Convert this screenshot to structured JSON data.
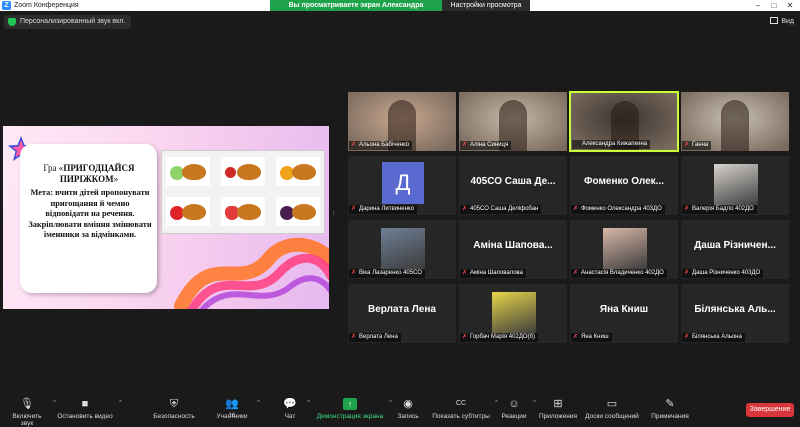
{
  "window": {
    "title": "Zoom Конференция",
    "share_notice": "Вы просматриваете экран Александра Кижапкина",
    "view_options": "Настройки просмотра",
    "personal_audio": "Персонализированный звук вкл.",
    "view_button": "Вид"
  },
  "slide": {
    "title_prefix": "Гра «",
    "title_bold": "ПРИГОДЦАЙСЯ ПИРІЖКОМ",
    "title_suffix": "»",
    "body": "Мета: вчити дітей пропонувати пригощання й чемно відповідати на речення. Закріплювати вміння змінювати іменники за відмінками."
  },
  "participants": [
    {
      "label": "Альона Бабіченко",
      "big": "",
      "muted": true,
      "kind": "photo",
      "color": "#c9a88f"
    },
    {
      "label": "Аліна Синиця",
      "big": "",
      "muted": true,
      "kind": "photo",
      "color": "#c7b9a6"
    },
    {
      "label": "Александра Кижапкина",
      "big": "",
      "muted": false,
      "kind": "photo",
      "color": "#3a3530",
      "active": true
    },
    {
      "label": "Ганна",
      "big": "",
      "muted": true,
      "kind": "photo",
      "color": "#c9c2b2"
    },
    {
      "label": "Дарина Литвиненко",
      "big": "",
      "muted": true,
      "kind": "avatar",
      "avatar": "Д"
    },
    {
      "label": "405СО Саша Деліфобан",
      "big": "405СО Саша Де...",
      "muted": true,
      "kind": "name"
    },
    {
      "label": "Фоменко Олександра 403ДО",
      "big": "Фоменко Олек...",
      "muted": true,
      "kind": "name"
    },
    {
      "label": "Валерія Бадло 402ДО",
      "big": "",
      "muted": true,
      "kind": "thumb",
      "color": "#d8d4cf"
    },
    {
      "label": "Віка Лазаренко 405СО",
      "big": "",
      "muted": true,
      "kind": "thumb",
      "color": "#6f7f95"
    },
    {
      "label": "Аміна Шаповалова",
      "big": "Аміна Шапова...",
      "muted": true,
      "kind": "name"
    },
    {
      "label": "Анастасія Владиченко 402ДО",
      "big": "",
      "muted": true,
      "kind": "thumb",
      "color": "#d9b8a8"
    },
    {
      "label": "Даша Різниченко 403ДО",
      "big": "Даша Різничен...",
      "muted": true,
      "kind": "name"
    },
    {
      "label": "Верлата Лена",
      "big": "Верлата Лена",
      "muted": true,
      "kind": "name"
    },
    {
      "label": "Горбач Марія 402ДО(б)",
      "big": "",
      "muted": true,
      "kind": "thumb",
      "color": "#e8d64a"
    },
    {
      "label": "Яна Книш",
      "big": "Яна Книш",
      "muted": true,
      "kind": "name"
    },
    {
      "label": "Білянська Альона",
      "big": "Білянська Аль...",
      "muted": true,
      "kind": "name"
    }
  ],
  "toolbar": {
    "unmute": "Включить звук",
    "start_video": "Остановить видео",
    "security": "Безопасность",
    "participants": "Участники",
    "participants_count": "16",
    "chat": "Чат",
    "share": "Демонстрация экрана",
    "record": "Запись",
    "captions": "Показать субтитры",
    "reactions": "Реакции",
    "apps": "Приложения",
    "whiteboards": "Доски сообщений",
    "notes": "Примечания",
    "end": "Завершение"
  },
  "colors": {
    "share_green": "#1fa34a",
    "active_border": "#c9ff38",
    "end_red": "#d8363a",
    "avatar_blue": "#5a6ad1"
  }
}
